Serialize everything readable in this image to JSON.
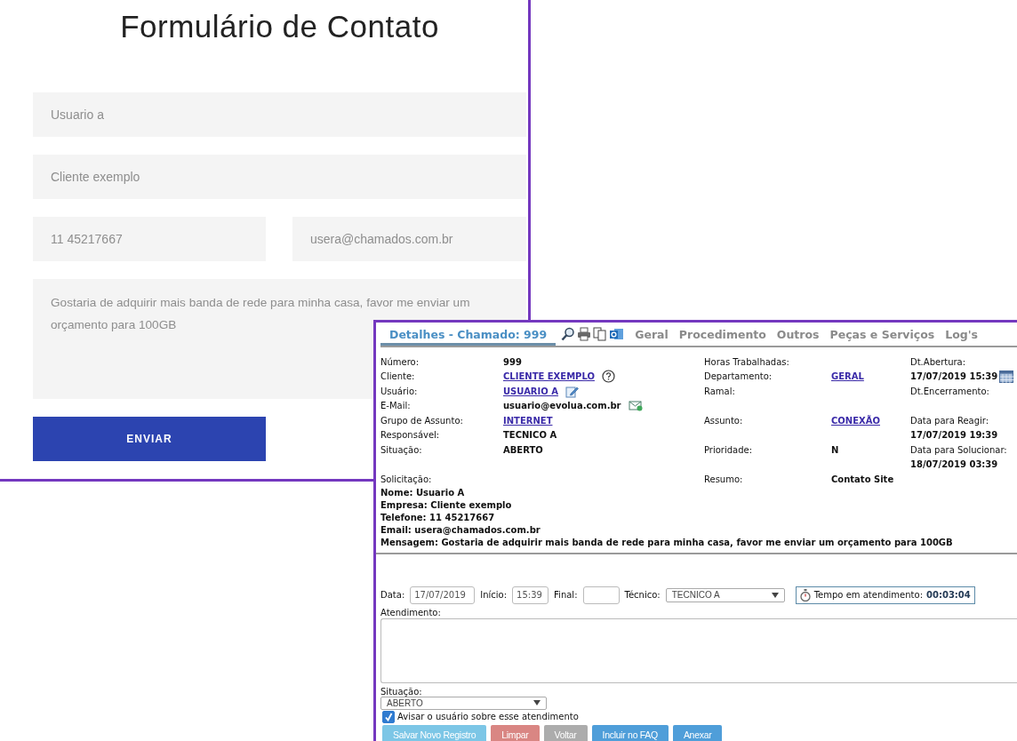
{
  "contact_form": {
    "title": "Formulário de Contato",
    "name_field": {
      "value": "Usuario a"
    },
    "company_field": {
      "value": "Cliente exemplo"
    },
    "phone_field": {
      "value": "11 45217667"
    },
    "email_field": {
      "value": "usera@chamados.com.br"
    },
    "message_field": {
      "value": "Gostaria de adquirir mais banda de rede para minha casa, favor me enviar um orçamento para 100GB"
    },
    "submit_button": "ENVIAR"
  },
  "ticket": {
    "tabs": [
      {
        "label": "Detalhes - Chamado: 999",
        "selected": true
      },
      {
        "label": "Geral",
        "selected": false
      },
      {
        "label": "Procedimento",
        "selected": false
      },
      {
        "label": "Outros",
        "selected": false
      },
      {
        "label": "Peças e Serviços",
        "selected": false
      },
      {
        "label": "Log's",
        "selected": false
      }
    ],
    "details": [
      {
        "left": {
          "label": "Número:",
          "value": "999",
          "kind": "bold"
        },
        "right": {
          "label": "Horas Trabalhadas:"
        },
        "far": {
          "text": "Dt.Abertura:",
          "kind": "label"
        }
      },
      {
        "left": {
          "label": "Cliente:",
          "value": "CLIENTE EXEMPLO",
          "kind": "link"
        },
        "right": {
          "label": "Departamento:",
          "value": "GERAL",
          "kind": "link"
        },
        "far": {
          "text": "17/07/2019 15:39",
          "kind": "bold"
        }
      },
      {
        "left": {
          "label": "Usuário:",
          "value": "USUARIO A",
          "kind": "link"
        },
        "right": {
          "label": "Ramal:"
        },
        "far": {
          "text": "Dt.Encerramento:",
          "kind": "label"
        }
      },
      {
        "left": {
          "label": "E-Mail:",
          "value": "usuario@evolua.com.br",
          "kind": "bold"
        }
      },
      {
        "left": {
          "label": "Grupo de Assunto:",
          "value": "INTERNET",
          "kind": "link"
        },
        "right": {
          "label": "Assunto:",
          "value": "CONEXÃO",
          "kind": "link"
        },
        "far": {
          "text": "Data para Reagir:",
          "kind": "label"
        }
      },
      {
        "left": {
          "label": "Responsável:",
          "value": "TECNICO A",
          "kind": "bold"
        },
        "far": {
          "text": "17/07/2019 19:39",
          "kind": "bold"
        }
      },
      {
        "left": {
          "label": "Situação:",
          "value": "ABERTO",
          "kind": "bold"
        },
        "right": {
          "label": "Prioridade:",
          "value": "N",
          "kind": "bold"
        },
        "far": {
          "text": "Data para Solucionar:",
          "kind": "label"
        }
      },
      {
        "far": {
          "text": "18/07/2019 03:39",
          "kind": "bold"
        }
      },
      {
        "left": {
          "label": "Solicitação:"
        },
        "right": {
          "label": "Resumo:",
          "value": "Contato Site",
          "kind": "bold"
        }
      }
    ],
    "request_lines": [
      "Nome: Usuario A",
      "Empresa: Cliente exemplo",
      "Telefone: 11 45217667",
      "Email: usera@chamados.com.br",
      "Mensagem: Gostaria de adquirir mais banda de rede para minha casa, favor me enviar um orçamento para 100GB"
    ],
    "entry": {
      "date_label": "Data:",
      "date": "17/07/2019",
      "start_label": "Início:",
      "start": "15:39",
      "end_label": "Final:",
      "tech_label": "Técnico:",
      "tech": "TECNICO A",
      "timer_label": "Tempo em atendimento:",
      "timer": "00:03:04",
      "notes_label": "Atendimento:",
      "status_label": "Situação:",
      "status": "ABERTO",
      "notify": {
        "label": "Avisar o usuário sobre esse atendimento",
        "checked": true
      }
    },
    "buttons": [
      {
        "label": "Salvar Novo Registro",
        "color": "#7cc6e6"
      },
      {
        "label": "Limpar",
        "color": "#d98683"
      },
      {
        "label": "Voltar",
        "color": "#acacac"
      },
      {
        "label": "Incluir no FAQ",
        "color": "#4f9ed9"
      },
      {
        "label": "Anexar",
        "color": "#4f9ed9"
      }
    ]
  }
}
